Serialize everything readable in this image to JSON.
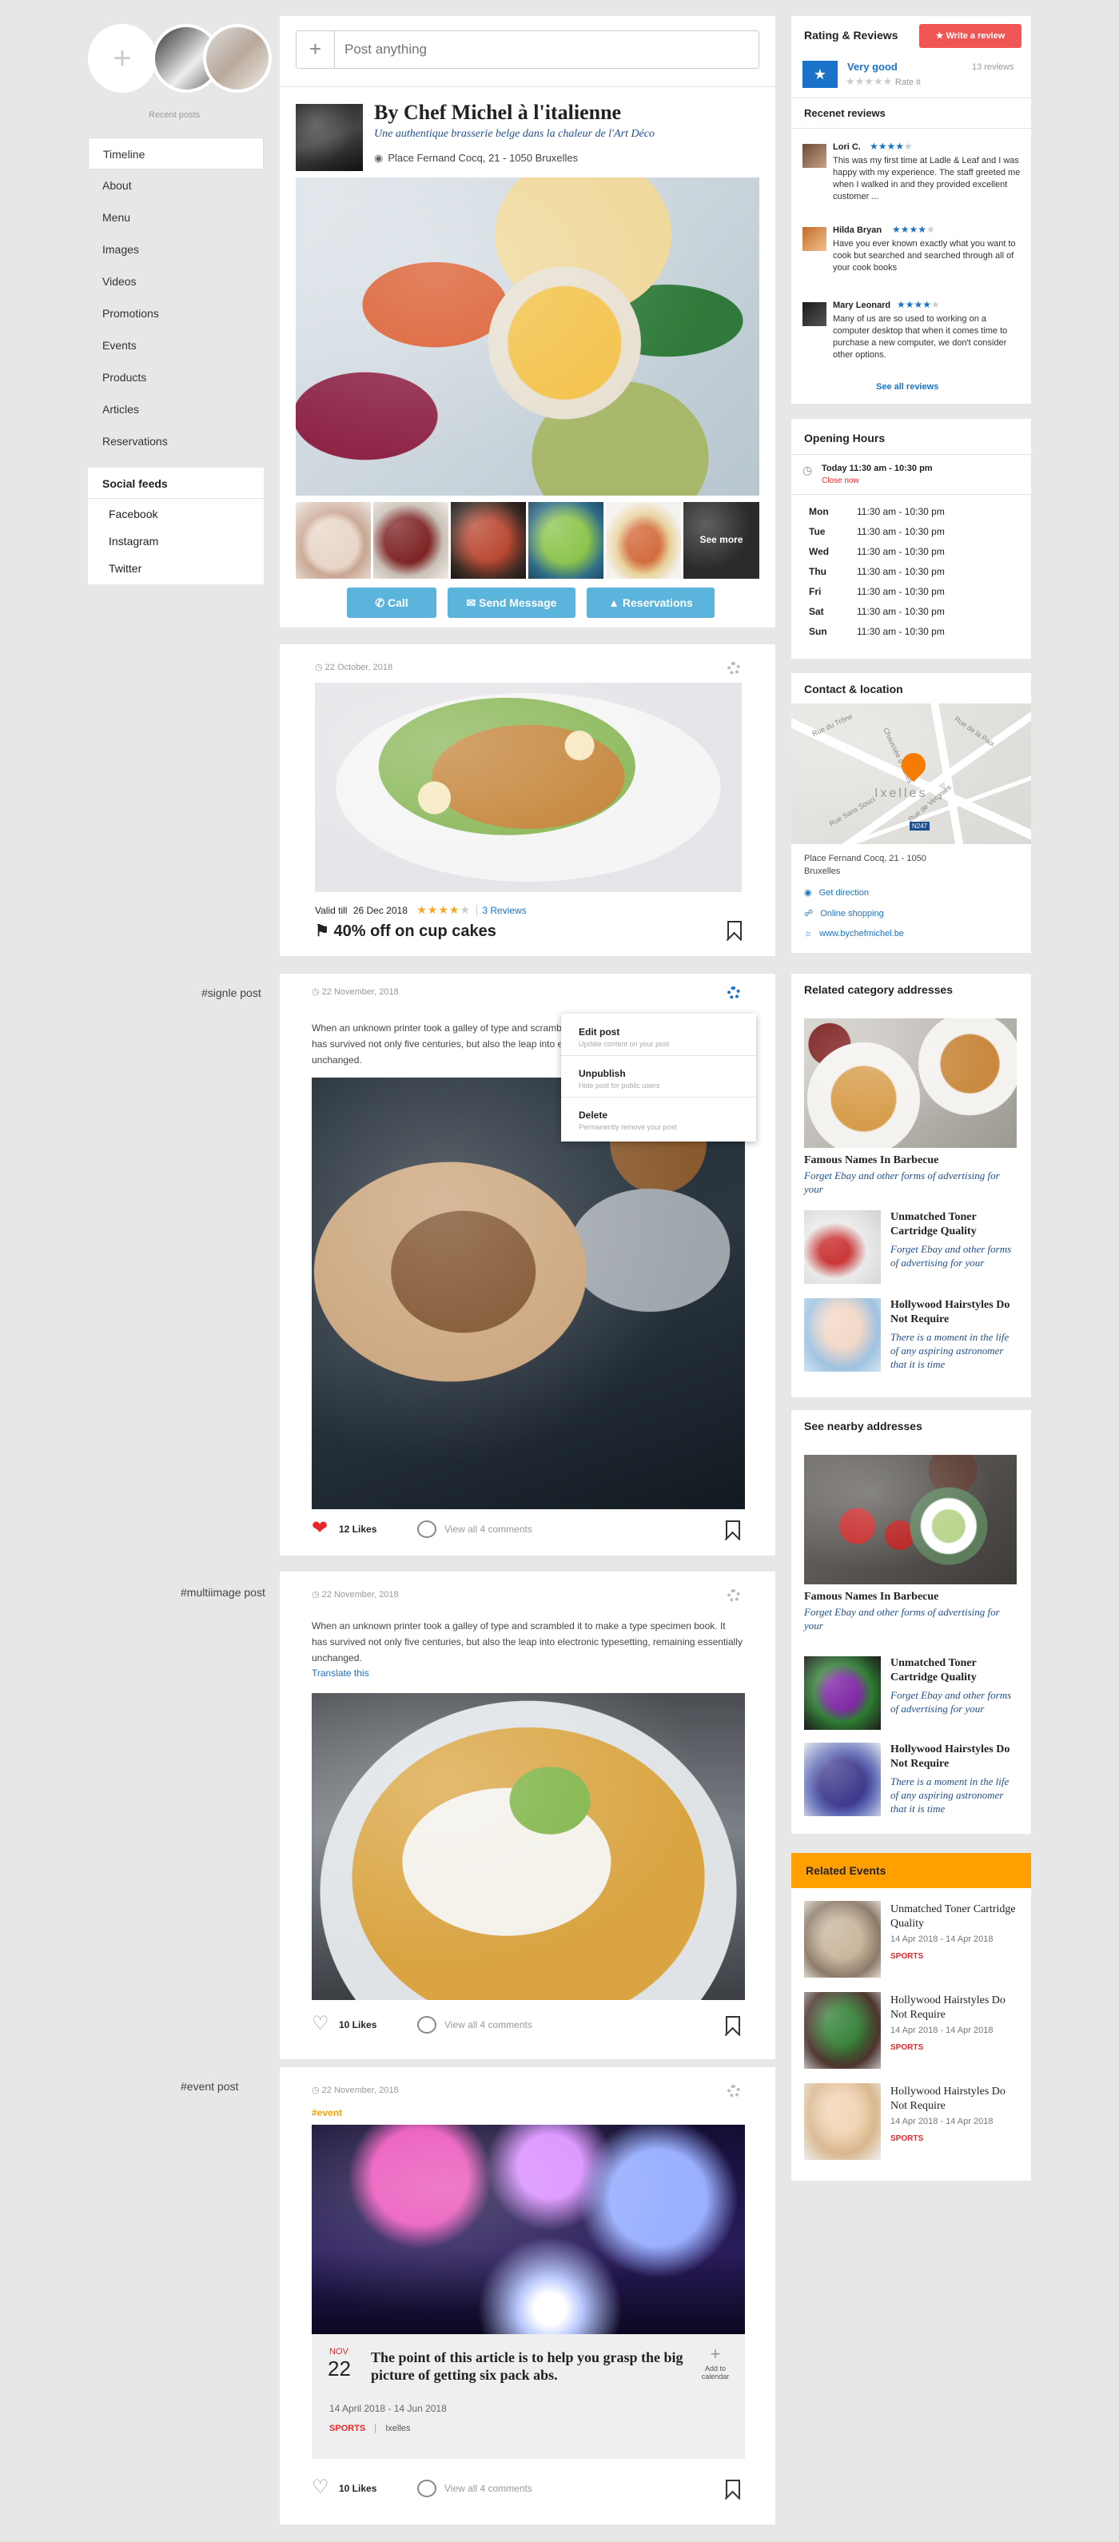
{
  "left": {
    "recent_posts_label": "Recent posts",
    "nav": [
      "Timeline",
      "About",
      "Menu",
      "Images",
      "Videos",
      "Promotions",
      "Events",
      "Products",
      "Articles",
      "Reservations"
    ],
    "social_title": "Social feeds",
    "social": [
      "Facebook",
      "Instagram",
      "Twitter"
    ]
  },
  "composer": {
    "placeholder": "Post anything",
    "plus": "+"
  },
  "profile": {
    "name": "By Chef Michel à l'italienne",
    "tagline": "Une authentique brasserie belge dans la chaleur de l'Art Déco",
    "address": "Place Fernand Cocq, 21 - 1050 Bruxelles",
    "see_more": "See more",
    "buttons": {
      "call": "Call",
      "message": "Send Message",
      "reservations": "Reservations"
    }
  },
  "promo_post": {
    "date": "22 October, 2018",
    "valid_label": "Valid till",
    "valid_date": "26 Dec 2018",
    "rating": 4,
    "reviews": "3 Reviews",
    "title": "40% off on cup cakes"
  },
  "single_post": {
    "tag": "#signle post",
    "date": "22 November, 2018",
    "text": "When an unknown printer took a galley of type and scrambled it to make a type specimen book. It has survived not only five centuries, but also the leap into electronic typesetting, remaining essentially unchanged.",
    "likes": "12 Likes",
    "comments": "View all 4 comments",
    "menu": [
      {
        "title": "Edit post",
        "desc": "Update content on your post"
      },
      {
        "title": "Unpublish",
        "desc": "Hide post for public users"
      },
      {
        "title": "Delete",
        "desc": "Permanently remove your post"
      }
    ]
  },
  "multi_post": {
    "tag": "#multiimage post",
    "date": "22 November, 2018",
    "text": "When an unknown printer took a galley of type and scrambled it to make a type specimen book. It has survived not only five centuries, but also the leap into electronic typesetting, remaining essentially unchanged.",
    "translate": "Translate this",
    "likes": "10 Likes",
    "comments": "View all 4 comments"
  },
  "event_post": {
    "tag": "#event post",
    "date": "22 November, 2018",
    "hashtag": "#event",
    "month": "NOV",
    "day": "22",
    "title": "The point of this article is to help you grasp the big picture of getting six pack abs.",
    "dates": "14 April 2018 - 14 Jun 2018",
    "category": "SPORTS",
    "place": "Ixelles",
    "add_calendar": "Add to calendar",
    "likes": "10 Likes",
    "comments": "View all 4 comments"
  },
  "rating": {
    "title": "Rating & Reviews",
    "write": "Write a review",
    "label": "Very good",
    "count": "13 reviews",
    "rate_it": "Rate it",
    "recent_title": "Recenet reviews",
    "reviews": [
      {
        "name": "Lori C.",
        "stars": 4,
        "text": "This was my first time at Ladle & Leaf and I was happy with my experience. The staff greeted me when I walked in and they provided excellent customer ..."
      },
      {
        "name": "Hilda Bryan",
        "stars": 4,
        "text": "Have you ever known exactly what you want to cook but searched and searched through all of your cook books"
      },
      {
        "name": "Mary Leonard",
        "stars": 4,
        "text": "Many of us are so used to working on a computer desktop that when it comes time to purchase a new computer, we don't consider other options."
      }
    ],
    "see_all": "See all reviews"
  },
  "hours": {
    "title": "Opening Hours",
    "today": "Today 11:30 am - 10:30 pm",
    "status": "Close now",
    "days": [
      {
        "d": "Mon",
        "h": "11:30 am - 10:30 pm"
      },
      {
        "d": "Tue",
        "h": "11:30 am - 10:30 pm"
      },
      {
        "d": "Wed",
        "h": "11:30 am - 10:30 pm"
      },
      {
        "d": "Thu",
        "h": "11:30 am - 10:30 pm"
      },
      {
        "d": "Fri",
        "h": "11:30 am - 10:30 pm"
      },
      {
        "d": "Sat",
        "h": "11:30 am - 10:30 pm"
      },
      {
        "d": "Sun",
        "h": "11:30 am - 10:30 pm"
      }
    ]
  },
  "contact": {
    "title": "Contact & location",
    "map_label": "Ixelles",
    "map_streets": [
      "Rue du Trône",
      "Rue de la Paix",
      "Chaussée d'Ixelles",
      "Rue de Vergnies",
      "Rue Sans Souci"
    ],
    "road_badge": "N247",
    "address1": "Place Fernand Cocq, 21 - 1050",
    "address2": "Bruxelles",
    "direction": "Get direction",
    "shop": "Online shopping",
    "web": "www.bychefmichel.be"
  },
  "related": {
    "title": "Related category addresses",
    "big_title": "Famous Names In Barbecue",
    "big_sub": "Forget Ebay and other forms of advertising for your",
    "items": [
      {
        "title": "Unmatched Toner Cartridge Quality",
        "sub": "Forget Ebay and other forms of advertising for your"
      },
      {
        "title": "Hollywood Hairstyles Do Not Require",
        "sub": "There is a moment in the life of any aspiring astronomer that it is time"
      }
    ]
  },
  "nearby": {
    "title": "See nearby addresses",
    "big_title": "Famous Names In Barbecue",
    "big_sub": "Forget Ebay and other forms of advertising for your",
    "items": [
      {
        "title": "Unmatched Toner Cartridge Quality",
        "sub": "Forget Ebay and other forms of advertising for your"
      },
      {
        "title": "Hollywood Hairstyles Do Not Require",
        "sub": "There is a moment in the life of any aspiring astronomer that it is time"
      }
    ]
  },
  "events": {
    "title": "Related Events",
    "items": [
      {
        "title": "Unmatched Toner Cartridge Quality",
        "dates": "14 Apr 2018 - 14 Apr 2018",
        "cat": "SPORTS"
      },
      {
        "title": "Hollywood Hairstyles Do Not Require",
        "dates": "14 Apr 2018 - 14 Apr 2018",
        "cat": "SPORTS"
      },
      {
        "title": "Hollywood Hairstyles Do Not Require",
        "dates": "14 Apr 2018 - 14 Apr 2018",
        "cat": "SPORTS"
      }
    ]
  },
  "colors": {
    "accent": "#1a73c8",
    "button": "#5ab4dc",
    "events": "#ff9f00",
    "sports": "#e8262b",
    "write_review": "#f05656"
  }
}
